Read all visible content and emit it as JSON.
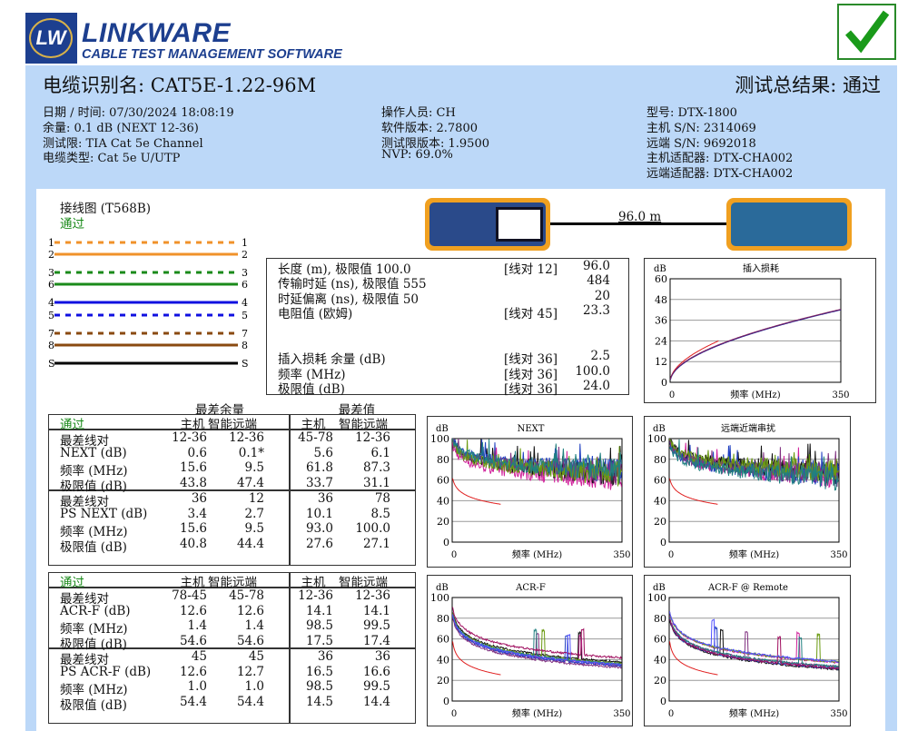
{
  "logo": {
    "mark": "LW",
    "name": "LINKWARE",
    "tagline": "CABLE TEST MANAGEMENT SOFTWARE"
  },
  "overall_icon": "check-icon",
  "header": {
    "cable_id": "电缆识别名: CAT5E-1.22-96M",
    "overall": "测试总结果: 通过"
  },
  "info": {
    "col1": [
      "日期 / 时间: 07/30/2024 18:08:19",
      "余量: 0.1 dB (NEXT 12-36)",
      "测试限: TIA Cat 5e Channel",
      "电缆类型: Cat 5e U/UTP"
    ],
    "col2": [
      "操作人员: CH",
      "软件版本: 2.7800",
      "测试限版本: 1.9500",
      "NVP: 69.0%"
    ],
    "col3": [
      "型号: DTX-1800",
      "主机 S/N: 2314069",
      "远端 S/N: 9692018",
      "主机适配器: DTX-CHA002",
      "远端适配器: DTX-CHA002"
    ]
  },
  "wiremap": {
    "title": "接线图 (T568B)",
    "result": "通过",
    "pairs": [
      {
        "pin": "1",
        "color": "#f0922a",
        "dashed": true
      },
      {
        "pin": "2",
        "color": "#f0922a",
        "dashed": false
      },
      {
        "pin": "3",
        "color": "#1a8a1a",
        "dashed": true
      },
      {
        "pin": "6",
        "color": "#1a8a1a",
        "dashed": false
      },
      {
        "pin": "4",
        "color": "#1010e0",
        "dashed": false
      },
      {
        "pin": "5",
        "color": "#1010e0",
        "dashed": true
      },
      {
        "pin": "7",
        "color": "#8a4a10",
        "dashed": true
      },
      {
        "pin": "8",
        "color": "#8a4a10",
        "dashed": false
      },
      {
        "pin": "S",
        "color": "#000000",
        "dashed": false
      }
    ]
  },
  "length_label": "96.0 m",
  "summary": {
    "rows": [
      {
        "label": "长度 (m), 极限值 100.0",
        "pair": "[线对 12]",
        "value": "96.0"
      },
      {
        "label": "传输时延 (ns), 极限值 555",
        "pair": "",
        "value": "484"
      },
      {
        "label": "时延偏离 (ns), 极限值 50",
        "pair": "",
        "value": "20"
      },
      {
        "label": "电阻值 (欧姆)",
        "pair": "[线对 45]",
        "value": "23.3"
      },
      {
        "label": "插入损耗 余量 (dB)",
        "pair": "[线对 36]",
        "value": "2.5"
      },
      {
        "label": "频率 (MHz)",
        "pair": "[线对 36]",
        "value": "100.0"
      },
      {
        "label": "极限值 (dB)",
        "pair": "[线对 36]",
        "value": "24.0"
      }
    ]
  },
  "tables_header": {
    "worst_margin": "最差余量",
    "worst_value": "最差值"
  },
  "table1": {
    "status": "通过",
    "cols": [
      "主机",
      "智能远端",
      "主机",
      "智能远端"
    ],
    "rows": [
      [
        "最差线对",
        "12-36",
        "12-36",
        "45-78",
        "12-36"
      ],
      [
        "NEXT (dB)",
        "0.6",
        "0.1*",
        "5.6",
        "6.1"
      ],
      [
        "频率 (MHz)",
        "15.6",
        "9.5",
        "61.8",
        "87.3"
      ],
      [
        "极限值 (dB)",
        "43.8",
        "47.4",
        "33.7",
        "31.1"
      ],
      [
        "最差线对",
        "36",
        "12",
        "36",
        "78"
      ],
      [
        "PS NEXT (dB)",
        "3.4",
        "2.7",
        "10.1",
        "8.5"
      ],
      [
        "频率 (MHz)",
        "15.6",
        "9.5",
        "93.0",
        "100.0"
      ],
      [
        "极限值 (dB)",
        "40.8",
        "44.4",
        "27.6",
        "27.1"
      ]
    ]
  },
  "table2": {
    "status": "通过",
    "cols": [
      "主机",
      "智能远端",
      "主机",
      "智能远端"
    ],
    "rows": [
      [
        "最差线对",
        "78-45",
        "45-78",
        "12-36",
        "12-36"
      ],
      [
        "ACR-F (dB)",
        "12.6",
        "12.6",
        "14.1",
        "14.1"
      ],
      [
        "频率 (MHz)",
        "1.4",
        "1.4",
        "98.5",
        "99.5"
      ],
      [
        "极限值 (dB)",
        "54.6",
        "54.6",
        "17.5",
        "17.4"
      ],
      [
        "最差线对",
        "45",
        "45",
        "36",
        "36"
      ],
      [
        "PS ACR-F (dB)",
        "12.6",
        "12.7",
        "16.5",
        "16.6"
      ],
      [
        "频率 (MHz)",
        "1.0",
        "1.0",
        "98.5",
        "99.5"
      ],
      [
        "极限值 (dB)",
        "54.4",
        "54.4",
        "14.5",
        "14.4"
      ]
    ]
  },
  "chart_data": [
    {
      "id": "il",
      "type": "line",
      "title": "插入损耗",
      "ylabel": "dB",
      "xlabel": "频率 (MHz)",
      "xlim": [
        0,
        350
      ],
      "ylim": [
        0,
        60
      ],
      "yticks": [
        "0",
        "12",
        "24",
        "36",
        "48",
        "60"
      ],
      "xticks": [
        "0",
        "350"
      ]
    },
    {
      "id": "next",
      "type": "line",
      "title": "NEXT",
      "ylabel": "dB",
      "xlabel": "频率 (MHz)",
      "xlim": [
        0,
        350
      ],
      "ylim": [
        0,
        100
      ],
      "yticks": [
        "0",
        "20",
        "40",
        "60",
        "80",
        "100"
      ],
      "xticks": [
        "0",
        "350"
      ]
    },
    {
      "id": "fext",
      "type": "line",
      "title": "远端近端串扰",
      "ylabel": "dB",
      "xlabel": "频率 (MHz)",
      "xlim": [
        0,
        350
      ],
      "ylim": [
        0,
        100
      ],
      "yticks": [
        "0",
        "20",
        "40",
        "60",
        "80",
        "100"
      ],
      "xticks": [
        "0",
        "350"
      ]
    },
    {
      "id": "acrf",
      "type": "line",
      "title": "ACR-F",
      "ylabel": "dB",
      "xlabel": "频率 (MHz)",
      "xlim": [
        0,
        350
      ],
      "ylim": [
        0,
        100
      ],
      "yticks": [
        "0",
        "20",
        "40",
        "60",
        "80",
        "100"
      ],
      "xticks": [
        "0",
        "350"
      ]
    },
    {
      "id": "acrfr",
      "type": "line",
      "title": "ACR-F @ Remote",
      "ylabel": "dB",
      "xlabel": "频率 (MHz)",
      "xlim": [
        0,
        350
      ],
      "ylim": [
        0,
        100
      ],
      "yticks": [
        "0",
        "20",
        "40",
        "60",
        "80",
        "100"
      ],
      "xticks": [
        "0",
        "350"
      ]
    }
  ],
  "colors": {
    "panel": "#bcd8f8",
    "brand": "#1d3f8f",
    "pass": "#1a8a1a",
    "limit": "#e02020"
  }
}
